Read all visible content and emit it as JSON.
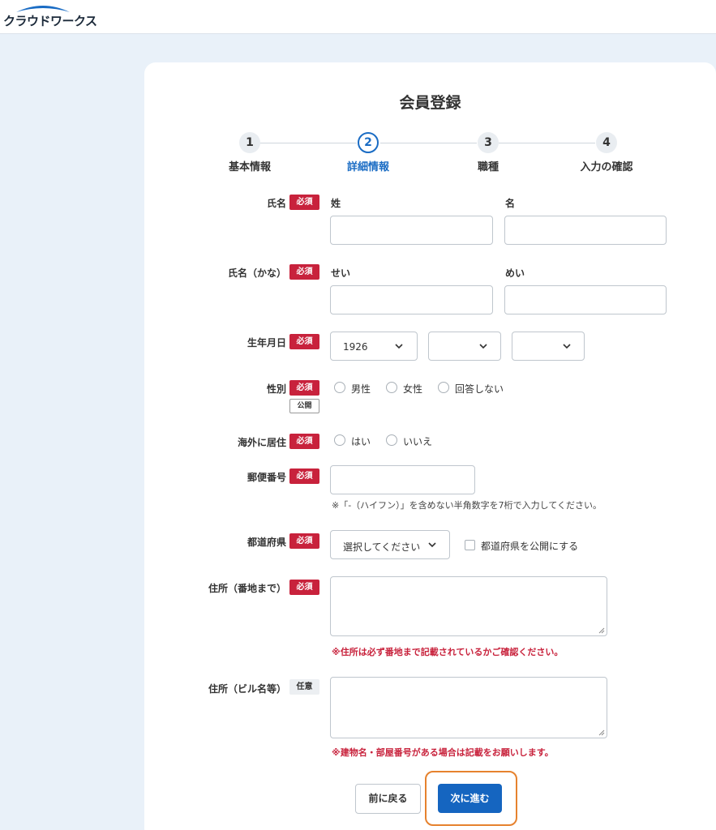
{
  "header": {
    "logo_text": "クラウドワークス"
  },
  "page": {
    "title": "会員登録"
  },
  "steps": [
    {
      "number": "1",
      "label": "基本情報"
    },
    {
      "number": "2",
      "label": "詳細情報"
    },
    {
      "number": "3",
      "label": "職種"
    },
    {
      "number": "4",
      "label": "入力の確認"
    }
  ],
  "badges": {
    "required": "必須",
    "public": "公開",
    "optional": "任意"
  },
  "form": {
    "name": {
      "label": "氏名",
      "last_label": "姓",
      "first_label": "名",
      "last_value": "",
      "first_value": ""
    },
    "kana": {
      "label": "氏名（かな）",
      "last_label": "せい",
      "first_label": "めい",
      "last_value": "",
      "first_value": ""
    },
    "birthdate": {
      "label": "生年月日",
      "year": "1926",
      "month": "",
      "day": ""
    },
    "gender": {
      "label": "性別",
      "options": [
        "男性",
        "女性",
        "回答しない"
      ]
    },
    "overseas": {
      "label": "海外に居住",
      "options": [
        "はい",
        "いいえ"
      ]
    },
    "postal": {
      "label": "郵便番号",
      "value": "",
      "note": "※「-（ハイフン）」を含めない半角数字を7桁で入力してください。"
    },
    "prefecture": {
      "label": "都道府県",
      "selected": "選択してください",
      "public_checkbox_label": "都道府県を公開にする"
    },
    "address": {
      "label": "住所（番地まで）",
      "value": "",
      "warning": "※住所は必ず番地まで記載されているかご確認ください。"
    },
    "building": {
      "label": "住所（ビル名等）",
      "value": "",
      "warning": "※建物名・部屋番号がある場合は記載をお願いします。"
    }
  },
  "buttons": {
    "back": "前に戻る",
    "next": "次に進む"
  },
  "colors": {
    "accent": "#1565c0",
    "required": "#c8223c",
    "focus": "#e6822e",
    "background": "#e9f1f9"
  }
}
